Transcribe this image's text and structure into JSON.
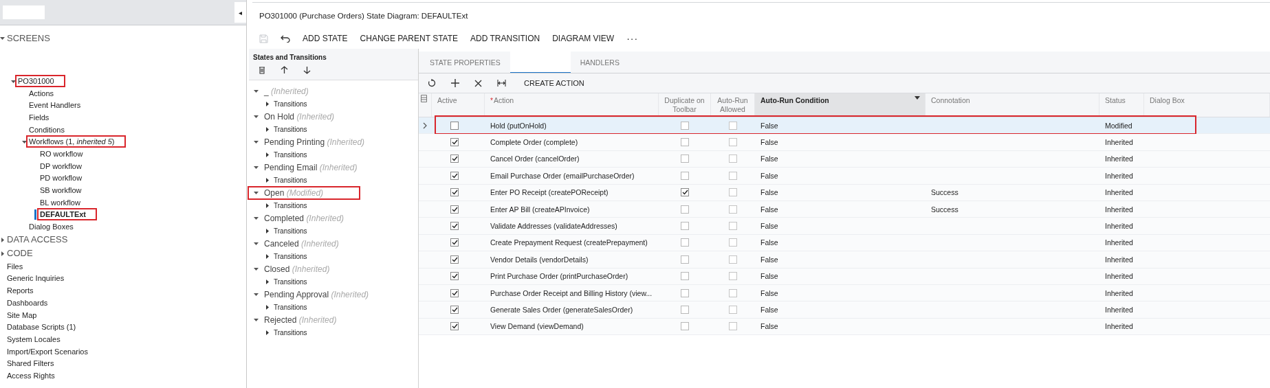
{
  "sidebar": {
    "collapse_glyph": "◂",
    "tree": [
      {
        "label": "SCREENS",
        "kind": "section",
        "expanded": true,
        "selected": false,
        "children": [
          {
            "label": "PO301000",
            "kind": "node",
            "expanded": true,
            "selected": false,
            "highlighted": true,
            "children": [
              {
                "label": "Actions",
                "kind": "item",
                "selected": false
              },
              {
                "label": "Event Handlers",
                "kind": "item",
                "selected": false
              },
              {
                "label": "Fields",
                "kind": "item",
                "selected": false
              },
              {
                "label": "Conditions",
                "kind": "item",
                "selected": false
              },
              {
                "label": "Workflows (1, *inherited 5*)",
                "kind": "node",
                "expanded": true,
                "selected": false,
                "highlighted": true,
                "children": [
                  {
                    "label": "RO workflow",
                    "kind": "item",
                    "selected": false
                  },
                  {
                    "label": "DP workflow",
                    "kind": "item",
                    "selected": false
                  },
                  {
                    "label": "PD workflow",
                    "kind": "item",
                    "selected": false
                  },
                  {
                    "label": "SB workflow",
                    "kind": "item",
                    "selected": false
                  },
                  {
                    "label": "BL workflow",
                    "kind": "item",
                    "selected": false
                  },
                  {
                    "label": "DEFAULTExt",
                    "kind": "item",
                    "selected": true,
                    "highlighted": true
                  }
                ]
              },
              {
                "label": "Dialog Boxes",
                "kind": "item",
                "selected": false
              }
            ]
          }
        ]
      },
      {
        "label": "DATA ACCESS",
        "kind": "section",
        "expanded": false,
        "selected": false
      },
      {
        "label": "CODE",
        "kind": "section",
        "expanded": false,
        "selected": false
      },
      {
        "label": "Files",
        "kind": "item",
        "selected": false
      },
      {
        "label": "Generic Inquiries",
        "kind": "item",
        "selected": false
      },
      {
        "label": "Reports",
        "kind": "item",
        "selected": false
      },
      {
        "label": "Dashboards",
        "kind": "item",
        "selected": false
      },
      {
        "label": "Site Map",
        "kind": "item",
        "selected": false
      },
      {
        "label": "Database Scripts (1)",
        "kind": "item",
        "selected": false
      },
      {
        "label": "System Locales",
        "kind": "item",
        "selected": false
      },
      {
        "label": "Import/Export Scenarios",
        "kind": "item",
        "selected": false
      },
      {
        "label": "Shared Filters",
        "kind": "item",
        "selected": false
      },
      {
        "label": "Access Rights",
        "kind": "item",
        "selected": false
      }
    ]
  },
  "page_title": "PO301000 (Purchase Orders) State Diagram: DEFAULTExt",
  "toolbar": {
    "buttons": [
      "ADD STATE",
      "CHANGE PARENT STATE",
      "ADD TRANSITION",
      "DIAGRAM VIEW"
    ],
    "more": "···"
  },
  "states_panel": {
    "title": "States and Transitions",
    "states": [
      {
        "name": "_",
        "status": "(Inherited)",
        "expanded": true,
        "highlighted": false,
        "children": [
          {
            "label": "Transitions",
            "expanded": false
          }
        ]
      },
      {
        "name": "On Hold",
        "status": "(Inherited)",
        "expanded": true,
        "highlighted": false,
        "children": [
          {
            "label": "Transitions",
            "expanded": false
          }
        ]
      },
      {
        "name": "Pending Printing",
        "status": "(Inherited)",
        "expanded": true,
        "highlighted": false,
        "children": [
          {
            "label": "Transitions",
            "expanded": false
          }
        ]
      },
      {
        "name": "Pending Email",
        "status": "(Inherited)",
        "expanded": true,
        "highlighted": false,
        "children": [
          {
            "label": "Transitions",
            "expanded": false
          }
        ]
      },
      {
        "name": "Open",
        "status": "(Modified)",
        "expanded": true,
        "highlighted": true,
        "children": [
          {
            "label": "Transitions",
            "expanded": false
          }
        ]
      },
      {
        "name": "Completed",
        "status": "(Inherited)",
        "expanded": true,
        "highlighted": false,
        "children": [
          {
            "label": "Transitions",
            "expanded": false
          }
        ]
      },
      {
        "name": "Canceled",
        "status": "(Inherited)",
        "expanded": true,
        "highlighted": false,
        "children": [
          {
            "label": "Transitions",
            "expanded": false
          }
        ]
      },
      {
        "name": "Closed",
        "status": "(Inherited)",
        "expanded": true,
        "highlighted": false,
        "children": [
          {
            "label": "Transitions",
            "expanded": false
          }
        ]
      },
      {
        "name": "Pending Approval",
        "status": "(Inherited)",
        "expanded": true,
        "highlighted": false,
        "children": [
          {
            "label": "Transitions",
            "expanded": false
          }
        ]
      },
      {
        "name": "Rejected",
        "status": "(Inherited)",
        "expanded": true,
        "highlighted": false,
        "children": [
          {
            "label": "Transitions",
            "expanded": false
          }
        ]
      }
    ]
  },
  "tabs": [
    {
      "label": "STATE PROPERTIES",
      "selected": false
    },
    {
      "kind": "blank",
      "selected": true
    },
    {
      "label": "HANDLERS",
      "selected": false
    }
  ],
  "grid_toolbar": {
    "create_button": "CREATE ACTION"
  },
  "table": {
    "required_mark": "*",
    "columns": [
      {
        "label": "Active",
        "required": false,
        "sorted": false
      },
      {
        "label": "Action",
        "required": true,
        "sorted": false
      },
      {
        "label": "Duplicate on Toolbar",
        "required": false,
        "sorted": false
      },
      {
        "label": "Auto-Run Allowed",
        "required": false,
        "sorted": false
      },
      {
        "label": "Auto-Run Condition",
        "required": false,
        "sorted": true
      },
      {
        "label": "Connotation",
        "required": false,
        "sorted": false
      },
      {
        "label": "Status",
        "required": false,
        "sorted": false
      },
      {
        "label": "Dialog Box",
        "required": false,
        "sorted": false
      }
    ],
    "rows": [
      {
        "active": false,
        "action": "Hold (putOnHold)",
        "duplicate": false,
        "auto_run": false,
        "condition": "False",
        "status": "Modified",
        "selected": true,
        "highlighted": true
      },
      {
        "active": true,
        "action": "Complete Order (complete)",
        "duplicate": false,
        "auto_run": false,
        "condition": "False",
        "status": "Inherited",
        "selected": false,
        "highlighted": false
      },
      {
        "active": true,
        "action": "Cancel Order (cancelOrder)",
        "duplicate": false,
        "auto_run": false,
        "condition": "False",
        "status": "Inherited",
        "selected": false,
        "highlighted": false
      },
      {
        "active": true,
        "action": "Email Purchase Order (emailPurchaseOrder)",
        "duplicate": false,
        "auto_run": false,
        "condition": "False",
        "status": "Inherited",
        "selected": false,
        "highlighted": false
      },
      {
        "active": true,
        "action": "Enter PO Receipt (createPOReceipt)",
        "duplicate": true,
        "auto_run": false,
        "condition": "False",
        "connotation": "Success",
        "status": "Inherited",
        "selected": false,
        "highlighted": false
      },
      {
        "active": true,
        "action": "Enter AP Bill (createAPInvoice)",
        "duplicate": false,
        "auto_run": false,
        "condition": "False",
        "connotation": "Success",
        "status": "Inherited",
        "selected": false,
        "highlighted": false
      },
      {
        "active": true,
        "action": "Validate Addresses (validateAddresses)",
        "duplicate": false,
        "auto_run": false,
        "condition": "False",
        "status": "Inherited",
        "selected": false,
        "highlighted": false
      },
      {
        "active": true,
        "action": "Create Prepayment Request (createPrepayment)",
        "duplicate": false,
        "auto_run": false,
        "condition": "False",
        "status": "Inherited",
        "selected": false,
        "highlighted": false
      },
      {
        "active": true,
        "action": "Vendor Details (vendorDetails)",
        "duplicate": false,
        "auto_run": false,
        "condition": "False",
        "status": "Inherited",
        "selected": false,
        "highlighted": false
      },
      {
        "active": true,
        "action": "Print Purchase Order (printPurchaseOrder)",
        "duplicate": false,
        "auto_run": false,
        "condition": "False",
        "status": "Inherited",
        "selected": false,
        "highlighted": false
      },
      {
        "active": true,
        "action": "Purchase Order Receipt and Billing History (view...",
        "duplicate": false,
        "auto_run": false,
        "condition": "False",
        "status": "Inherited",
        "selected": false,
        "highlighted": false
      },
      {
        "active": true,
        "action": "Generate Sales Order (generateSalesOrder)",
        "duplicate": false,
        "auto_run": false,
        "condition": "False",
        "status": "Inherited",
        "selected": false,
        "highlighted": false
      },
      {
        "active": true,
        "action": "View Demand (viewDemand)",
        "duplicate": false,
        "auto_run": false,
        "condition": "False",
        "status": "Inherited",
        "selected": false,
        "highlighted": false
      }
    ]
  }
}
